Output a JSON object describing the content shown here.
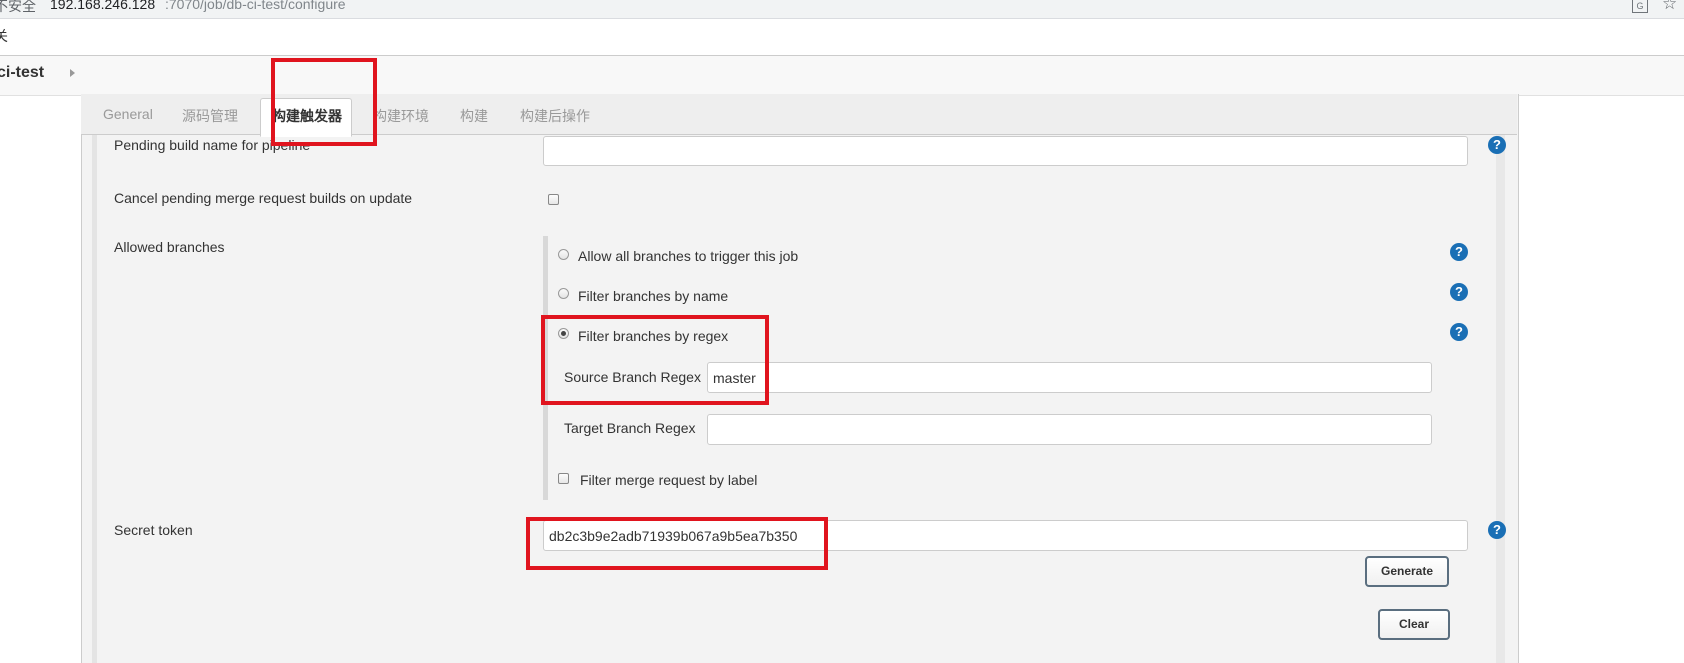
{
  "browser": {
    "security_label": "不安全",
    "host": "192.168.246.128",
    "path": ":7070/job/db-ci-test/configure",
    "bookmark_fragment": "关"
  },
  "breadcrumb": {
    "job_name": "ci-test"
  },
  "tabs": [
    {
      "label": "General"
    },
    {
      "label": "源码管理"
    },
    {
      "label": "构建触发器",
      "active": true
    },
    {
      "label": "构建环境"
    },
    {
      "label": "构建"
    },
    {
      "label": "构建后操作"
    }
  ],
  "form": {
    "pending_build_name_label": "Pending build name for pipeline",
    "pending_build_name_value": "",
    "cancel_pending_label": "Cancel pending merge request builds on update",
    "cancel_pending_checked": false,
    "allowed_branches_label": "Allowed branches",
    "branch_options": [
      {
        "label": "Allow all branches to trigger this job",
        "checked": false
      },
      {
        "label": "Filter branches by name",
        "checked": false
      },
      {
        "label": "Filter branches by regex",
        "checked": true
      }
    ],
    "source_regex_label": "Source Branch Regex",
    "source_regex_value": "master",
    "target_regex_label": "Target Branch Regex",
    "target_regex_value": "",
    "filter_label_label": "Filter merge request by label",
    "filter_label_checked": false,
    "secret_token_label": "Secret token",
    "secret_token_value": "db2c3b9e2adb71939b067a9b5ea7b350",
    "generate_label": "Generate",
    "clear_label": "Clear"
  },
  "help_icon_glyph": "?",
  "colors": {
    "highlight_box": "#e0141e",
    "help_icon": "#1a6fb5",
    "panel_bg": "#f3f3f3"
  }
}
